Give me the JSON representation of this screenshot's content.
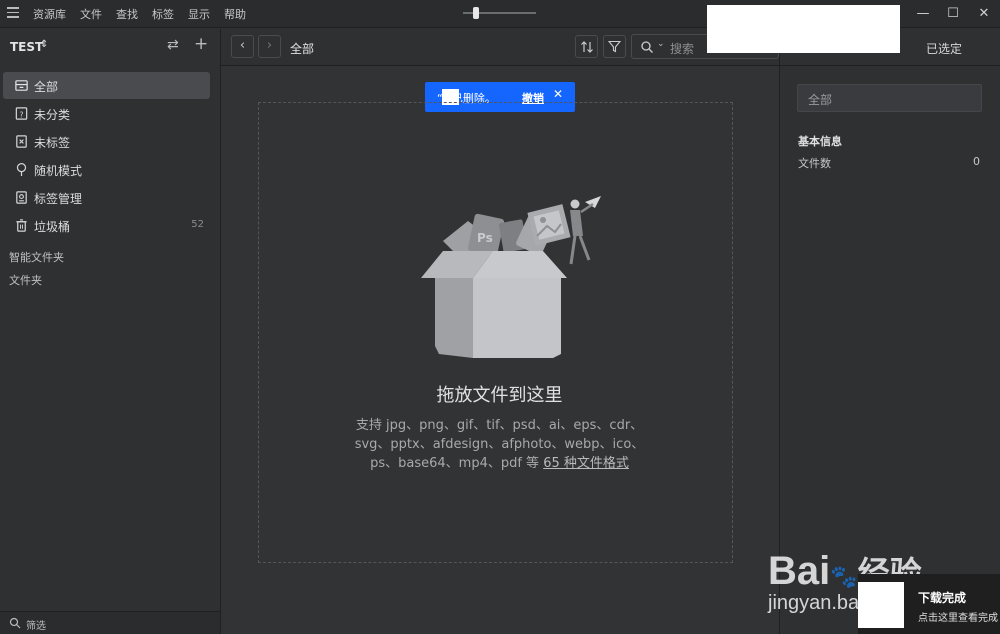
{
  "menu": {
    "items": [
      "资源库",
      "文件",
      "查找",
      "标签",
      "显示",
      "帮助"
    ]
  },
  "window_controls": [
    "—",
    "☐",
    "✕"
  ],
  "sidebar": {
    "library_name": "TEST",
    "nav": [
      {
        "label": "全部",
        "icon": "inbox-icon",
        "active": true,
        "count": ""
      },
      {
        "label": "未分类",
        "icon": "question-file-icon",
        "active": false,
        "count": ""
      },
      {
        "label": "未标签",
        "icon": "untagged-icon",
        "active": false,
        "count": ""
      },
      {
        "label": "随机模式",
        "icon": "bulb-icon",
        "active": false,
        "count": ""
      },
      {
        "label": "标签管理",
        "icon": "tag-manage-icon",
        "active": false,
        "count": ""
      },
      {
        "label": "垃圾桶",
        "icon": "trash-icon",
        "active": false,
        "count": "52"
      }
    ],
    "sections": {
      "smart_folders": "智能文件夹",
      "folders": "文件夹"
    },
    "footer_filter": "筛选"
  },
  "toolbar": {
    "breadcrumb": "全部",
    "search_placeholder": "搜索"
  },
  "toast": {
    "message": "“  ”已删除。",
    "undo": "撤销",
    "close": "✕"
  },
  "main": {
    "drop_title": "拖放文件到这里",
    "formats_line1": "支持 jpg、png、gif、tif、psd、ai、eps、cdr、",
    "formats_line2": "svg、pptx、afdesign、afphoto、webp、ico、",
    "formats_line3": "ps、base64、mp4、pdf 等",
    "formats_link": "65 种文件格式"
  },
  "right_panel": {
    "selected_label": "已选定",
    "name_field": "全部",
    "section_title": "基本信息",
    "file_count_label": "文件数",
    "file_count_value": "0"
  },
  "watermark": {
    "brand": "Bai",
    "brand2": "经验",
    "url": "jingyan.baidu.com"
  },
  "download_popup": {
    "title": "下载完成",
    "subtitle": "点击这里查看完成"
  }
}
